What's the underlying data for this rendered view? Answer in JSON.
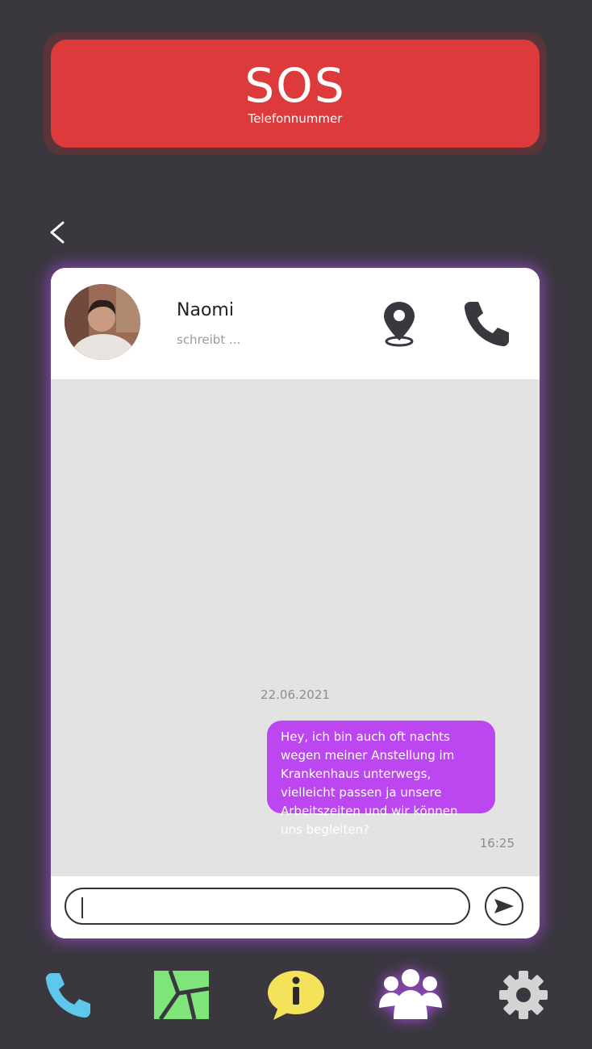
{
  "sos": {
    "title": "SOS",
    "subtitle": "Telefonnummer"
  },
  "header": {
    "contact_name": "Naomi",
    "contact_status": "schreibt ..."
  },
  "chat": {
    "date": "22.06.2021",
    "messages": [
      {
        "text": "Hey, ich bin auch oft nachts wegen meiner Anstellung im Krankenhaus unterwegs, vielleicht passen ja unsere Arbeitszeiten und wir können uns begleiten?",
        "time": "16:25",
        "direction": "outgoing"
      }
    ]
  },
  "input": {
    "value": "",
    "placeholder": ""
  },
  "icons": {
    "back": "chevron-left-icon",
    "location": "map-pin-icon",
    "call": "phone-icon",
    "send": "send-icon"
  },
  "nav": [
    {
      "icon": "phone-icon",
      "color": "#5ec8ec"
    },
    {
      "icon": "map-icon",
      "color": "#7fe57a"
    },
    {
      "icon": "info-icon",
      "color": "#f4e35a"
    },
    {
      "icon": "group-icon",
      "color": "#ffffff",
      "active": true
    },
    {
      "icon": "gear-icon",
      "color": "#d4d4d4"
    }
  ],
  "colors": {
    "background": "#3a373f",
    "sos": "#dd3a3b",
    "bubble": "#bc46f0",
    "chat_bg": "#e3e3e3",
    "glow": "#be50ff"
  }
}
